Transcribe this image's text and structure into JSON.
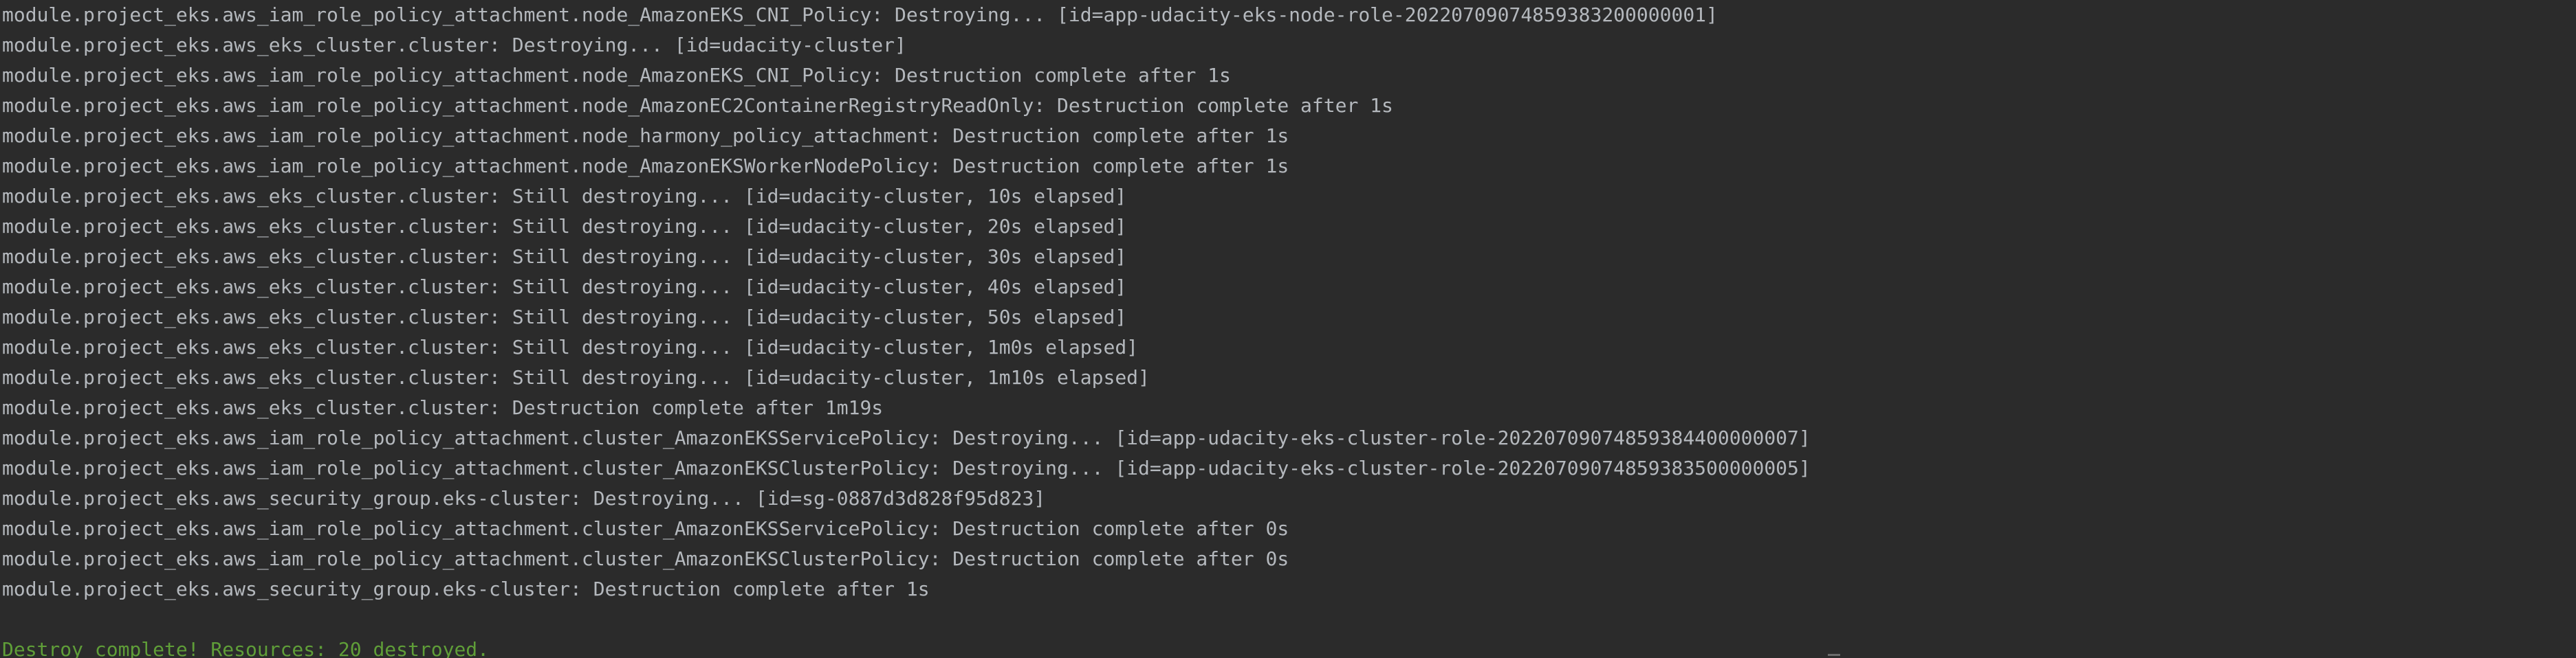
{
  "terminal": {
    "lines": [
      "module.project_eks.aws_iam_role_policy_attachment.node_AmazonEKS_CNI_Policy: Destroying... [id=app-udacity-eks-node-role-20220709074859383200000001]",
      "module.project_eks.aws_eks_cluster.cluster: Destroying... [id=udacity-cluster]",
      "module.project_eks.aws_iam_role_policy_attachment.node_AmazonEKS_CNI_Policy: Destruction complete after 1s",
      "module.project_eks.aws_iam_role_policy_attachment.node_AmazonEC2ContainerRegistryReadOnly: Destruction complete after 1s",
      "module.project_eks.aws_iam_role_policy_attachment.node_harmony_policy_attachment: Destruction complete after 1s",
      "module.project_eks.aws_iam_role_policy_attachment.node_AmazonEKSWorkerNodePolicy: Destruction complete after 1s",
      "module.project_eks.aws_eks_cluster.cluster: Still destroying... [id=udacity-cluster, 10s elapsed]",
      "module.project_eks.aws_eks_cluster.cluster: Still destroying... [id=udacity-cluster, 20s elapsed]",
      "module.project_eks.aws_eks_cluster.cluster: Still destroying... [id=udacity-cluster, 30s elapsed]",
      "module.project_eks.aws_eks_cluster.cluster: Still destroying... [id=udacity-cluster, 40s elapsed]",
      "module.project_eks.aws_eks_cluster.cluster: Still destroying... [id=udacity-cluster, 50s elapsed]",
      "module.project_eks.aws_eks_cluster.cluster: Still destroying... [id=udacity-cluster, 1m0s elapsed]",
      "module.project_eks.aws_eks_cluster.cluster: Still destroying... [id=udacity-cluster, 1m10s elapsed]",
      "module.project_eks.aws_eks_cluster.cluster: Destruction complete after 1m19s",
      "module.project_eks.aws_iam_role_policy_attachment.cluster_AmazonEKSServicePolicy: Destroying... [id=app-udacity-eks-cluster-role-20220709074859384400000007]",
      "module.project_eks.aws_iam_role_policy_attachment.cluster_AmazonEKSClusterPolicy: Destroying... [id=app-udacity-eks-cluster-role-20220709074859383500000005]",
      "module.project_eks.aws_security_group.eks-cluster: Destroying... [id=sg-0887d3d828f95d823]",
      "module.project_eks.aws_iam_role_policy_attachment.cluster_AmazonEKSServicePolicy: Destruction complete after 0s",
      "module.project_eks.aws_iam_role_policy_attachment.cluster_AmazonEKSClusterPolicy: Destruction complete after 0s",
      "module.project_eks.aws_security_group.eks-cluster: Destruction complete after 1s"
    ],
    "summary": "Destroy complete! Resources: 20 destroyed.",
    "colors": {
      "background": "#2b2b2b",
      "text": "#b4b8bd",
      "success": "#5f9e38"
    }
  }
}
